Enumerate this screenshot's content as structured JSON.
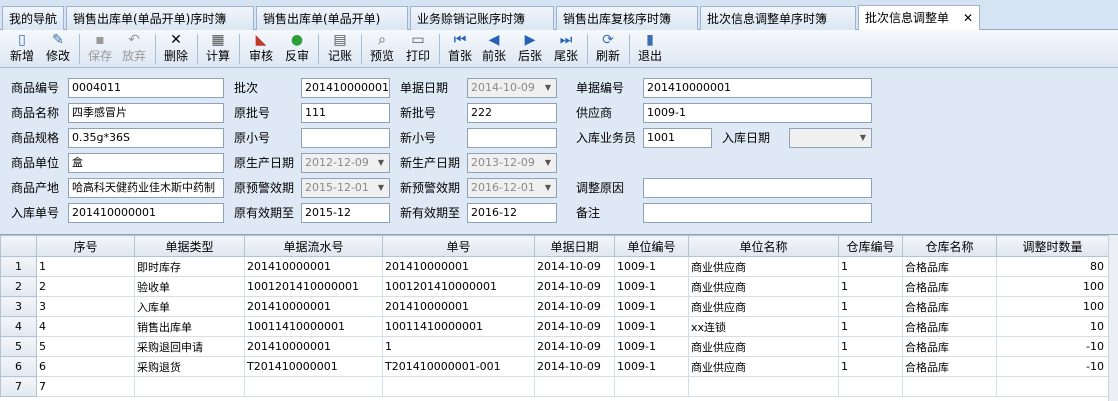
{
  "tabs": [
    {
      "label": "我的导航"
    },
    {
      "label": "销售出库单(单品开单)序时簿"
    },
    {
      "label": "销售出库单(单品开单)"
    },
    {
      "label": "业务赊销记账序时簿"
    },
    {
      "label": "销售出库复核序时簿"
    },
    {
      "label": "批次信息调整单序时簿"
    },
    {
      "label": "批次信息调整单",
      "close": "✕"
    }
  ],
  "toolbar": {
    "new": "新增",
    "edit": "修改",
    "save": "保存",
    "discard": "放弃",
    "delete": "删除",
    "calc": "计算",
    "audit": "审核",
    "unaudit": "反审",
    "post": "记账",
    "preview": "预览",
    "print": "打印",
    "first": "首张",
    "prev": "前张",
    "next": "后张",
    "last": "尾张",
    "refresh": "刷新",
    "exit": "退出"
  },
  "form": {
    "product_code": {
      "label": "商品编号",
      "value": "0004011"
    },
    "batch": {
      "label": "批次",
      "value": "201410000001"
    },
    "doc_date": {
      "label": "单据日期",
      "value": "2014-10-09"
    },
    "doc_no": {
      "label": "单据编号",
      "value": "201410000001"
    },
    "product_name": {
      "label": "商品名称",
      "value": "四季感冒片"
    },
    "orig_batch": {
      "label": "原批号",
      "value": "111"
    },
    "new_batch": {
      "label": "新批号",
      "value": "222"
    },
    "supplier": {
      "label": "供应商",
      "value": "1009-1"
    },
    "spec": {
      "label": "商品规格",
      "value": "0.35g*36S"
    },
    "orig_small": {
      "label": "原小号",
      "value": ""
    },
    "new_small": {
      "label": "新小号",
      "value": ""
    },
    "clerk": {
      "label": "入库业务员",
      "value": "1001"
    },
    "in_date": {
      "label": "入库日期",
      "value": ""
    },
    "unit": {
      "label": "商品单位",
      "value": "盒"
    },
    "orig_prod_date": {
      "label": "原生产日期",
      "value": "2012-12-09"
    },
    "new_prod_date": {
      "label": "新生产日期",
      "value": "2013-12-09"
    },
    "origin": {
      "label": "商品产地",
      "value": "哈高科天健药业佳木斯中药制"
    },
    "orig_warn": {
      "label": "原预警效期",
      "value": "2015-12-01"
    },
    "new_warn": {
      "label": "新预警效期",
      "value": "2016-12-01"
    },
    "reason": {
      "label": "调整原因",
      "value": ""
    },
    "in_no": {
      "label": "入库单号",
      "value": "201410000001"
    },
    "orig_expiry": {
      "label": "原有效期至",
      "value": "2015-12"
    },
    "new_expiry": {
      "label": "新有效期至",
      "value": "2016-12"
    },
    "remark": {
      "label": "备注",
      "value": ""
    }
  },
  "grid": {
    "columns": [
      "序号",
      "单据类型",
      "单据流水号",
      "单号",
      "单据日期",
      "单位编号",
      "单位名称",
      "仓库编号",
      "仓库名称",
      "调整时数量"
    ],
    "rows": [
      {
        "rn": "1",
        "cells": [
          "1",
          "即时库存",
          "201410000001",
          "201410000001",
          "2014-10-09",
          "1009-1",
          "商业供应商",
          "1",
          "合格品库",
          "80"
        ]
      },
      {
        "rn": "2",
        "cells": [
          "2",
          "验收单",
          "1001201410000001",
          "1001201410000001",
          "2014-10-09",
          "1009-1",
          "商业供应商",
          "1",
          "合格品库",
          "100"
        ]
      },
      {
        "rn": "3",
        "cells": [
          "3",
          "入库单",
          "201410000001",
          "201410000001",
          "2014-10-09",
          "1009-1",
          "商业供应商",
          "1",
          "合格品库",
          "100"
        ]
      },
      {
        "rn": "4",
        "cells": [
          "4",
          "销售出库单",
          "10011410000001",
          "10011410000001",
          "2014-10-09",
          "1009-1",
          "xx连锁",
          "1",
          "合格品库",
          "10"
        ]
      },
      {
        "rn": "5",
        "cells": [
          "5",
          "采购退回申请",
          "201410000001",
          "1",
          "2014-10-09",
          "1009-1",
          "商业供应商",
          "1",
          "合格品库",
          "-10"
        ]
      },
      {
        "rn": "6",
        "cells": [
          "6",
          "采购退货",
          "T201410000001",
          "T201410000001-001",
          "2014-10-09",
          "1009-1",
          "商业供应商",
          "1",
          "合格品库",
          "-10"
        ]
      },
      {
        "rn": "7",
        "cells": [
          "7",
          "",
          "",
          "",
          "",
          "",
          "",
          "",
          "",
          ""
        ]
      }
    ]
  }
}
